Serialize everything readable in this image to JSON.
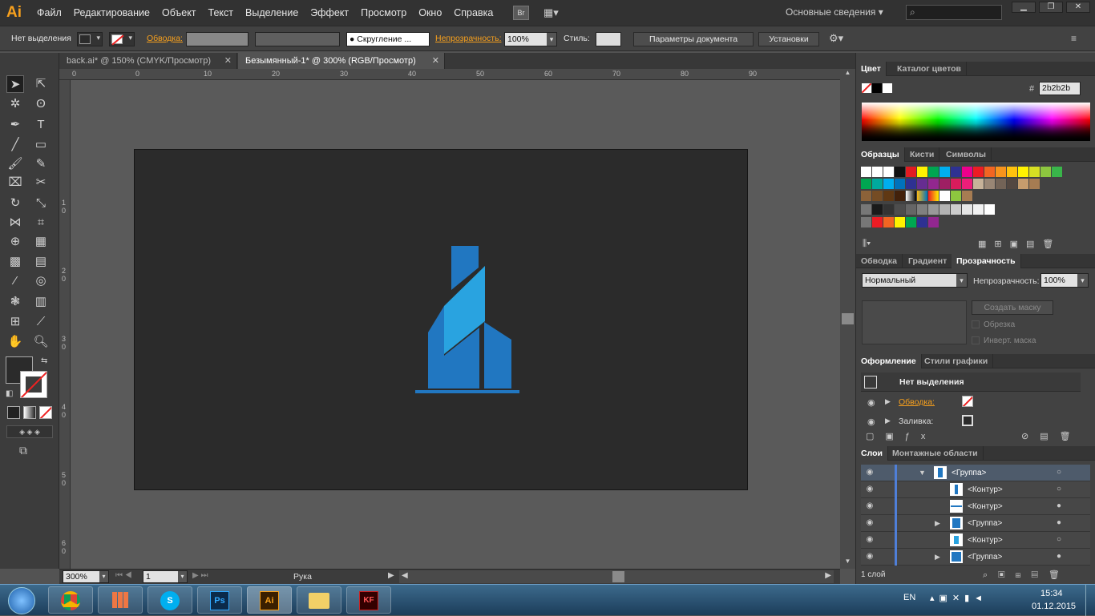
{
  "app": {
    "logo": "Ai"
  },
  "menu": [
    "Файл",
    "Редактирование",
    "Объект",
    "Текст",
    "Выделение",
    "Эффект",
    "Просмотр",
    "Окно",
    "Справка"
  ],
  "menu_right": {
    "br_badge": "Br",
    "workspace": "Основные сведения",
    "search_placeholder": ""
  },
  "control": {
    "selection": "Нет выделения",
    "stroke_label": "Обводка:",
    "brush": "Скругление ...",
    "opacity_label": "Непрозрачность:",
    "opacity_value": "100%",
    "style_label": "Стиль:",
    "doc_settings": "Параметры документа",
    "preferences": "Установки"
  },
  "tabs": [
    {
      "label": "back.ai* @ 150% (CMYK/Просмотр)"
    },
    {
      "label": "Безымянный-1* @ 300% (RGB/Просмотр)"
    }
  ],
  "ruler_h": [
    "0",
    "0",
    "10",
    "20",
    "30",
    "40",
    "50",
    "60",
    "70",
    "80",
    "90"
  ],
  "ruler_v": [
    "1",
    "0",
    "2",
    "0",
    "3",
    "0",
    "4",
    "0",
    "5",
    "0",
    "6",
    "0"
  ],
  "status": {
    "zoom": "300%",
    "artboard": "1",
    "tool": "Рука"
  },
  "panels": {
    "color": {
      "tab1": "Цвет",
      "tab2": "Каталог цветов",
      "hex_label": "#",
      "hex": "2b2b2b"
    },
    "swatches": {
      "tab1": "Образцы",
      "tab2": "Кисти",
      "tab3": "Символы"
    },
    "transparency": {
      "tab1": "Обводка",
      "tab2": "Градиент",
      "tab3": "Прозрачность",
      "blend_mode": "Нормальный",
      "opacity_label": "Непрозрачность:",
      "opacity_value": "100%",
      "make_mask": "Создать маску",
      "clip": "Обрезка",
      "invert": "Инверт. маска"
    },
    "appearance": {
      "tab1": "Оформление",
      "tab2": "Стили графики",
      "title": "Нет выделения",
      "stroke": "Обводка:",
      "fill": "Заливка:"
    },
    "layers": {
      "tab1": "Слои",
      "tab2": "Монтажные области",
      "rows": [
        {
          "label": "<Группа>"
        },
        {
          "label": "<Контур>"
        },
        {
          "label": "<Контур>"
        },
        {
          "label": "<Группа>"
        },
        {
          "label": "<Контур>"
        },
        {
          "label": "<Группа>"
        }
      ],
      "count": "1 слой"
    }
  },
  "taskbar": {
    "lang": "EN",
    "time": "15:34",
    "date": "01.12.2015"
  },
  "colors": {
    "accent_orange": "#f7a01d",
    "logo_blue": "#2177c1",
    "logo_light": "#29a3e0",
    "artboard": "#2b2b2b"
  }
}
